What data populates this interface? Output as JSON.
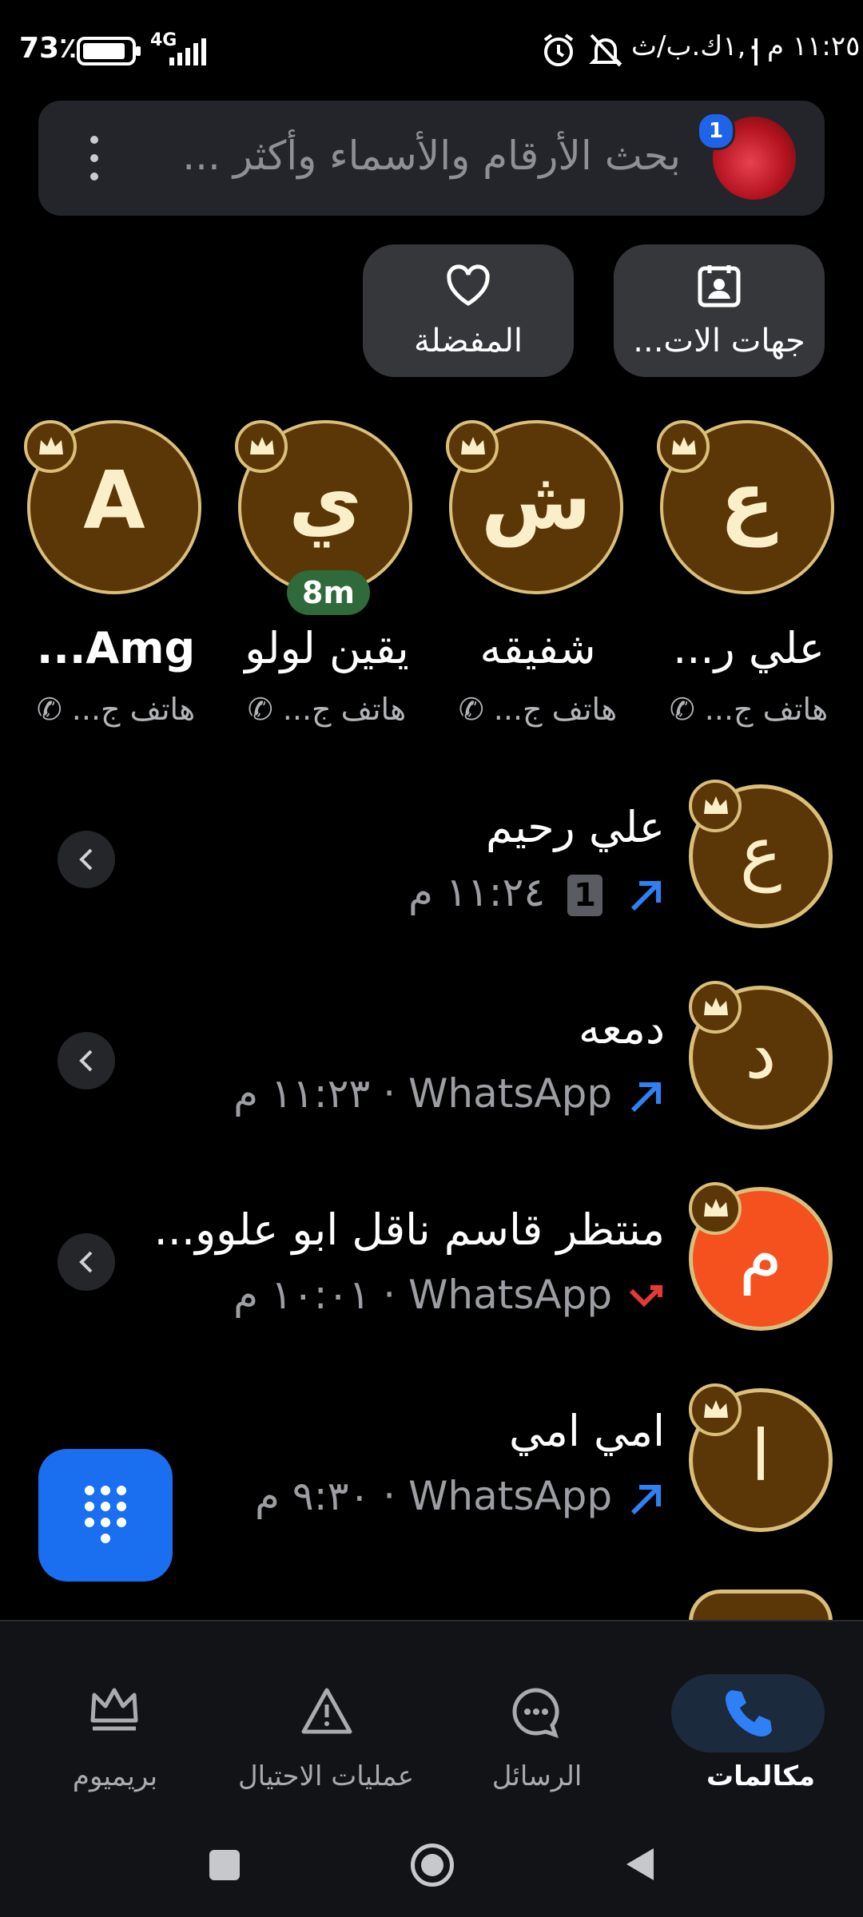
{
  "status_bar": {
    "time": "١١:٢٥ م",
    "data_speed": "١,٠ك.ب/ث",
    "network": "4G",
    "battery": "73٪"
  },
  "search": {
    "placeholder": "بحث الأرقام والأسماء وأكثر ...",
    "avatar_badge": "1"
  },
  "quick_actions": [
    {
      "label": "جهات الات...",
      "icon": "contact-card-icon"
    },
    {
      "label": "المفضلة",
      "icon": "heart-icon"
    }
  ],
  "favorites": [
    {
      "letter": "ع",
      "name": "علي ر...",
      "sub": "هاتف ج..."
    },
    {
      "letter": "ش",
      "name": "شفيقه",
      "sub": "هاتف ج..."
    },
    {
      "letter": "ي",
      "name": "يقين لولو",
      "sub": "هاتف ج...",
      "tag": "8m"
    },
    {
      "letter": "A",
      "name": "Amg...",
      "sub": "هاتف ج..."
    }
  ],
  "calls": [
    {
      "letter": "ع",
      "name": "علي رحيم",
      "sim": "1",
      "source": "",
      "time": "١١:٢٤ م",
      "direction": "outgoing"
    },
    {
      "letter": "د",
      "name": "دمعه",
      "sim": "",
      "source": "WhatsApp",
      "time": "١١:٢٣ م",
      "direction": "outgoing"
    },
    {
      "letter": "م",
      "name": "منتظر قاسم ناقل ابو علوو...",
      "sim": "",
      "source": "WhatsApp",
      "time": "١٠:٠١ م",
      "direction": "missed"
    },
    {
      "letter": "ا",
      "name": "امي امي",
      "sim": "",
      "source": "WhatsApp",
      "time": "٩:٣٠ م",
      "direction": "outgoing"
    }
  ],
  "bottom_nav": [
    {
      "label": "مكالمات",
      "icon": "phone-icon",
      "active": true
    },
    {
      "label": "الرسائل",
      "icon": "chat-bubble-icon",
      "active": false
    },
    {
      "label": "عمليات الاحتيال",
      "icon": "warning-triangle-icon",
      "active": false
    },
    {
      "label": "بريميوم",
      "icon": "crown-icon",
      "active": false
    }
  ],
  "colors": {
    "background": "#000000",
    "accent_blue": "#1a6ff0",
    "gold": "#d9bf7a",
    "avatar_brown": "#5b3606",
    "avatar_orange": "#f4511e",
    "missed_red": "#e53935"
  }
}
